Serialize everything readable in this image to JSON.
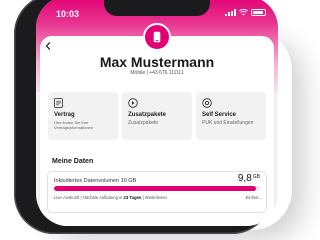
{
  "status_bar": {
    "time": "10:03"
  },
  "profile": {
    "back_icon": "chevron-left-icon",
    "avatar_icon": "phone-icon",
    "name": "Max Mustermann",
    "mobile": "Mobile | +43 676 111111"
  },
  "tiles": [
    {
      "icon": "contract-icon",
      "title": "Vertrag",
      "subtitle": "Hier finden Sie Ihre Vertragsinformationen"
    },
    {
      "icon": "add-package-icon",
      "title": "Zusatzpakete",
      "subtitle": "Zusatzpakete"
    },
    {
      "icon": "settings-icon",
      "title": "Self Service",
      "subtitle": "PUK und Einstellungen"
    }
  ],
  "my_data": {
    "heading": "Meine Daten",
    "label": "Inkludiertes Datenvolumen 10 GB",
    "value": "9,8",
    "unit": "GB",
    "remaining_fraction": 0.98,
    "note_prefix": "Live-Auskunft | Nächste Aufladung in",
    "note_bold": "23 Tagen",
    "note_suffix": "| Weiterlesen",
    "note_more": "Einheit..."
  },
  "colors": {
    "accent": "#e20074"
  }
}
